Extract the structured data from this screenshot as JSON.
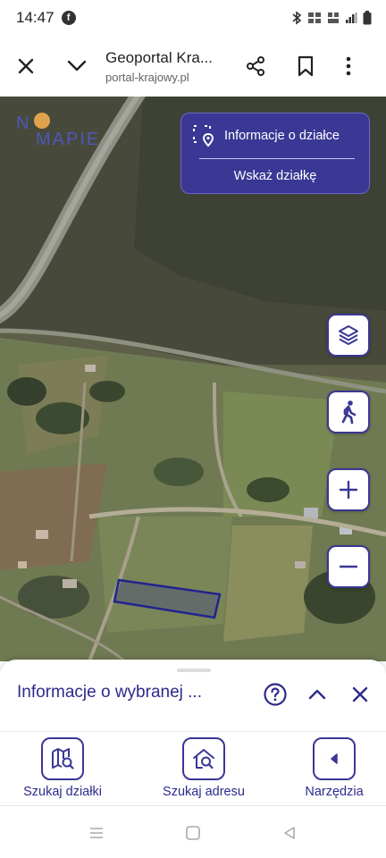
{
  "status_bar": {
    "time": "14:47",
    "facebook_icon": "f",
    "icons": [
      "bluetooth-icon",
      "volte-lte-icon",
      "lte-icon",
      "signal-icon",
      "battery-icon"
    ]
  },
  "browser": {
    "page_title": "Geoportal Kra...",
    "url": "portal-krajowy.pl"
  },
  "map": {
    "logo_top": "N",
    "logo_bottom": "MAPIE",
    "info_panel": {
      "title": "Informacje o działce",
      "subtitle": "Wskaż działkę"
    },
    "controls": [
      "layers-icon",
      "pedestrian-icon",
      "zoom-in-icon",
      "zoom-out-icon"
    ]
  },
  "sheet": {
    "title": "Informacje o wybranej ..."
  },
  "bottom_nav": {
    "items": [
      {
        "label": "Szukaj działki",
        "icon": "map-search-icon"
      },
      {
        "label": "Szukaj adresu",
        "icon": "home-search-icon"
      },
      {
        "label": "Narzędzia",
        "icon": "chevron-left-icon"
      }
    ]
  },
  "colors": {
    "accent": "#3a3795",
    "accent_text": "#2d2a8c",
    "parcel_outline": "#2a2c9c"
  }
}
